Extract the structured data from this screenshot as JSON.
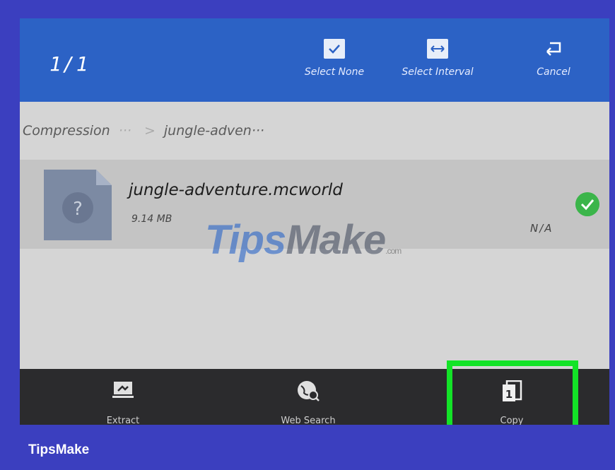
{
  "topbar": {
    "counter": "1/1",
    "actions": [
      {
        "label": "Select None",
        "icon": "check-box-icon"
      },
      {
        "label": "Select Interval",
        "icon": "interval-arrows-icon"
      },
      {
        "label": "Cancel",
        "icon": "return-arrow-icon"
      }
    ]
  },
  "breadcrumb": {
    "root": "Compression",
    "ellipsis1": "···",
    "separator": ">",
    "current": "jungle-adven···"
  },
  "file": {
    "name": "jungle-adventure.mcworld",
    "size": "9.14 MB",
    "date": "N/A",
    "icon": "unknown-file-icon",
    "selected": true
  },
  "watermark": {
    "tips": "Tips",
    "make": "Make",
    "dotcom": ".com"
  },
  "toolbar": {
    "items": [
      {
        "label": "Extract",
        "icon": "extract-icon"
      },
      {
        "label": "Web Search",
        "icon": "web-search-icon"
      },
      {
        "label": "Copy",
        "icon": "copy-icon",
        "highlighted": true
      }
    ]
  },
  "brand": "TipsMake",
  "colors": {
    "background": "#3b3fbf",
    "topbar": "#2c62c5",
    "selected_check": "#3bb54a",
    "highlight": "#13e327",
    "bottombar": "#2b2b2d"
  }
}
